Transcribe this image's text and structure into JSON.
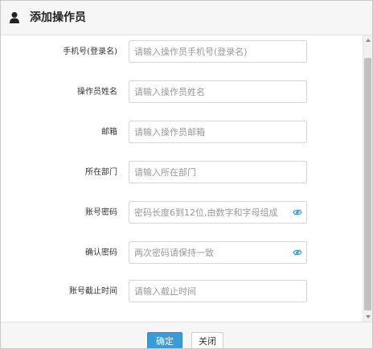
{
  "dialog": {
    "title": "添加操作员",
    "icon": "user-icon"
  },
  "form": {
    "fields": [
      {
        "label": "手机号(登录名)",
        "placeholder": "请输入操作员手机号(登录名)"
      },
      {
        "label": "操作员姓名",
        "placeholder": "请输入操作员姓名"
      },
      {
        "label": "邮箱",
        "placeholder": "请输入操作员邮箱"
      },
      {
        "label": "所在部门",
        "placeholder": "请输入所在部门"
      },
      {
        "label": "账号密码",
        "placeholder": "密码长度6到12位,由数字和字母组成",
        "icon": "eye-icon"
      },
      {
        "label": "确认密码",
        "placeholder": "两次密码请保持一致",
        "icon": "eye-icon"
      },
      {
        "label": "账号截止时间",
        "placeholder": "请输入截止时间"
      }
    ]
  },
  "footer": {
    "ok_label": "确定",
    "close_label": "关闭"
  },
  "colors": {
    "primary_button": "#3a9bd8",
    "eye_icon": "#3a9bd8"
  }
}
